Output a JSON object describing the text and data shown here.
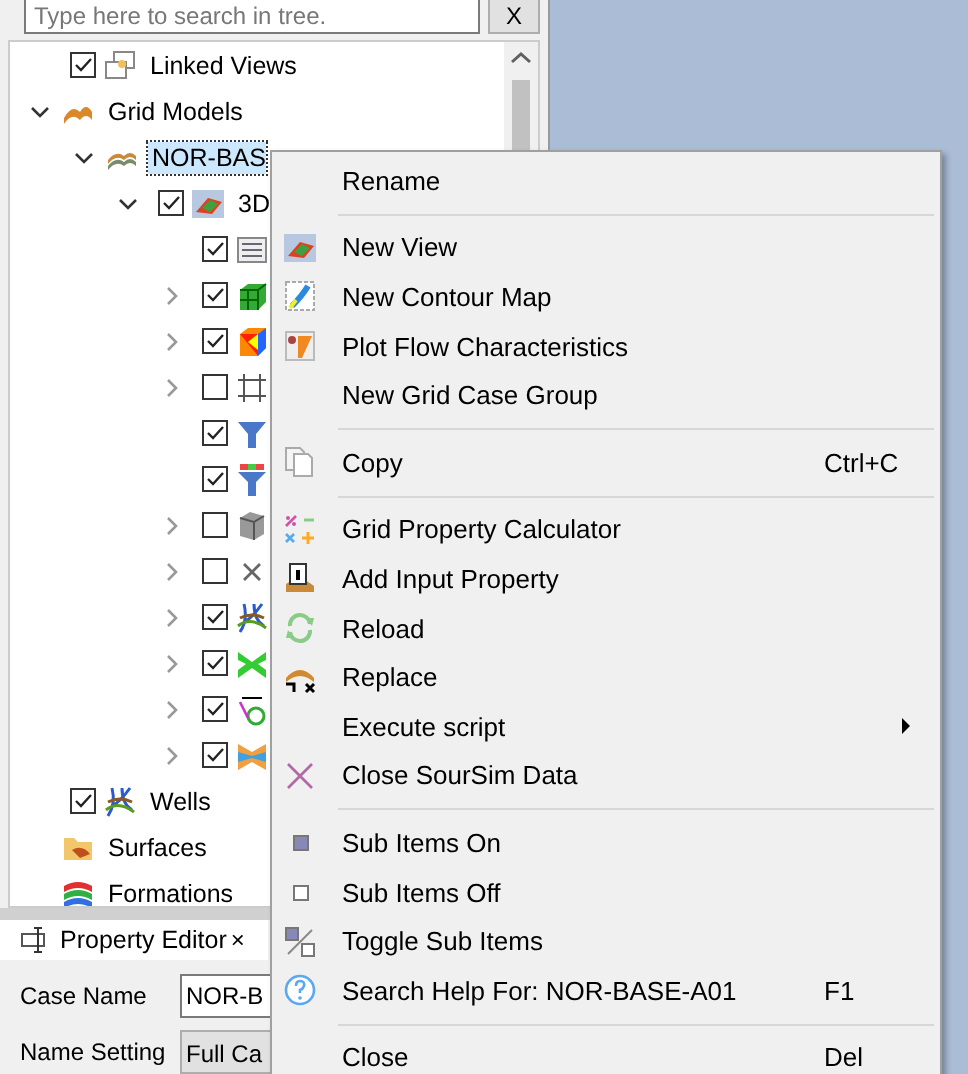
{
  "search": {
    "placeholder": "Type here to search in tree.",
    "clear": "X"
  },
  "tree": [
    {
      "label": "Linked Views",
      "checked": true,
      "kind": "linked"
    },
    {
      "label": "Grid Models",
      "expanded": true,
      "kind": "grid",
      "children": [
        {
          "label": "NOR-BAS",
          "expanded": true,
          "selected": true,
          "kind": "case",
          "children": [
            {
              "label": "3D",
              "expanded": true,
              "checked": true,
              "kind": "view",
              "children": [
                {
                  "checked": true,
                  "kind": "info"
                },
                {
                  "expanded": false,
                  "checked": true,
                  "kind": "cube"
                },
                {
                  "expanded": false,
                  "checked": true,
                  "kind": "cells"
                },
                {
                  "expanded": false,
                  "checked": false,
                  "kind": "section"
                },
                {
                  "checked": true,
                  "kind": "filter"
                },
                {
                  "checked": true,
                  "kind": "filter2"
                },
                {
                  "expanded": false,
                  "checked": false,
                  "kind": "box"
                },
                {
                  "expanded": false,
                  "checked": false,
                  "kind": "cross"
                },
                {
                  "expanded": false,
                  "checked": true,
                  "kind": "wells"
                },
                {
                  "expanded": false,
                  "checked": true,
                  "kind": "fault"
                },
                {
                  "expanded": false,
                  "checked": true,
                  "kind": "text"
                },
                {
                  "expanded": false,
                  "checked": true,
                  "kind": "surface"
                }
              ]
            }
          ]
        }
      ]
    },
    {
      "label": "Wells",
      "checked": true,
      "kind": "wells"
    },
    {
      "label": "Surfaces",
      "kind": "folder"
    },
    {
      "label": "Formations",
      "kind": "formations"
    }
  ],
  "property_editor": {
    "title": "Property Editor",
    "close": "×",
    "rows": [
      {
        "label": "Case Name",
        "value": "NOR-B",
        "kind": "text"
      },
      {
        "label": "Name Setting",
        "value": "Full Ca",
        "kind": "combo"
      }
    ]
  },
  "context_menu": [
    {
      "kind": "plain",
      "label": "Rename"
    },
    {
      "kind": "separator"
    },
    {
      "kind": "view",
      "label": "New View"
    },
    {
      "kind": "contour",
      "label": "New Contour Map"
    },
    {
      "kind": "flow",
      "label": "Plot Flow Characteristics"
    },
    {
      "kind": "plain",
      "label": "New Grid Case Group"
    },
    {
      "kind": "separator"
    },
    {
      "kind": "copy",
      "label": "Copy",
      "shortcut": "Ctrl+C"
    },
    {
      "kind": "separator"
    },
    {
      "kind": "calc",
      "label": "Grid Property Calculator"
    },
    {
      "kind": "info",
      "label": "Add Input Property"
    },
    {
      "kind": "reload",
      "label": "Reload"
    },
    {
      "kind": "replace",
      "label": "Replace"
    },
    {
      "kind": "plain",
      "label": "Execute script",
      "submenu": true
    },
    {
      "kind": "close",
      "label": "Close SourSim Data"
    },
    {
      "kind": "separator"
    },
    {
      "kind": "on",
      "label": "Sub Items On"
    },
    {
      "kind": "off",
      "label": "Sub Items Off"
    },
    {
      "kind": "toggle",
      "label": "Toggle Sub Items"
    },
    {
      "kind": "help",
      "label": "Search Help For: NOR-BASE-A01",
      "shortcut": "F1"
    },
    {
      "kind": "separator"
    },
    {
      "kind": "plain",
      "label": "Close",
      "shortcut": "Del"
    }
  ]
}
